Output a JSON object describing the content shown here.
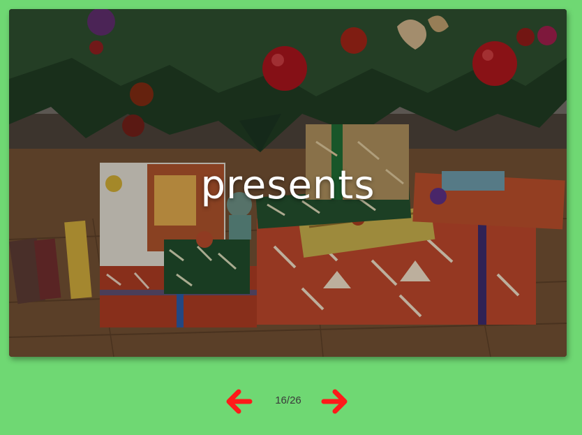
{
  "slideshow": {
    "caption": "presents",
    "image_subject": "wrapped-christmas-presents-under-tree",
    "counter": "16/26",
    "prev_icon": "arrow-left-icon",
    "next_icon": "arrow-right-icon"
  },
  "colors": {
    "background": "#6fd873",
    "arrow": "#ff1a1a",
    "caption": "#ffffff",
    "counter": "#3a3a3a"
  }
}
